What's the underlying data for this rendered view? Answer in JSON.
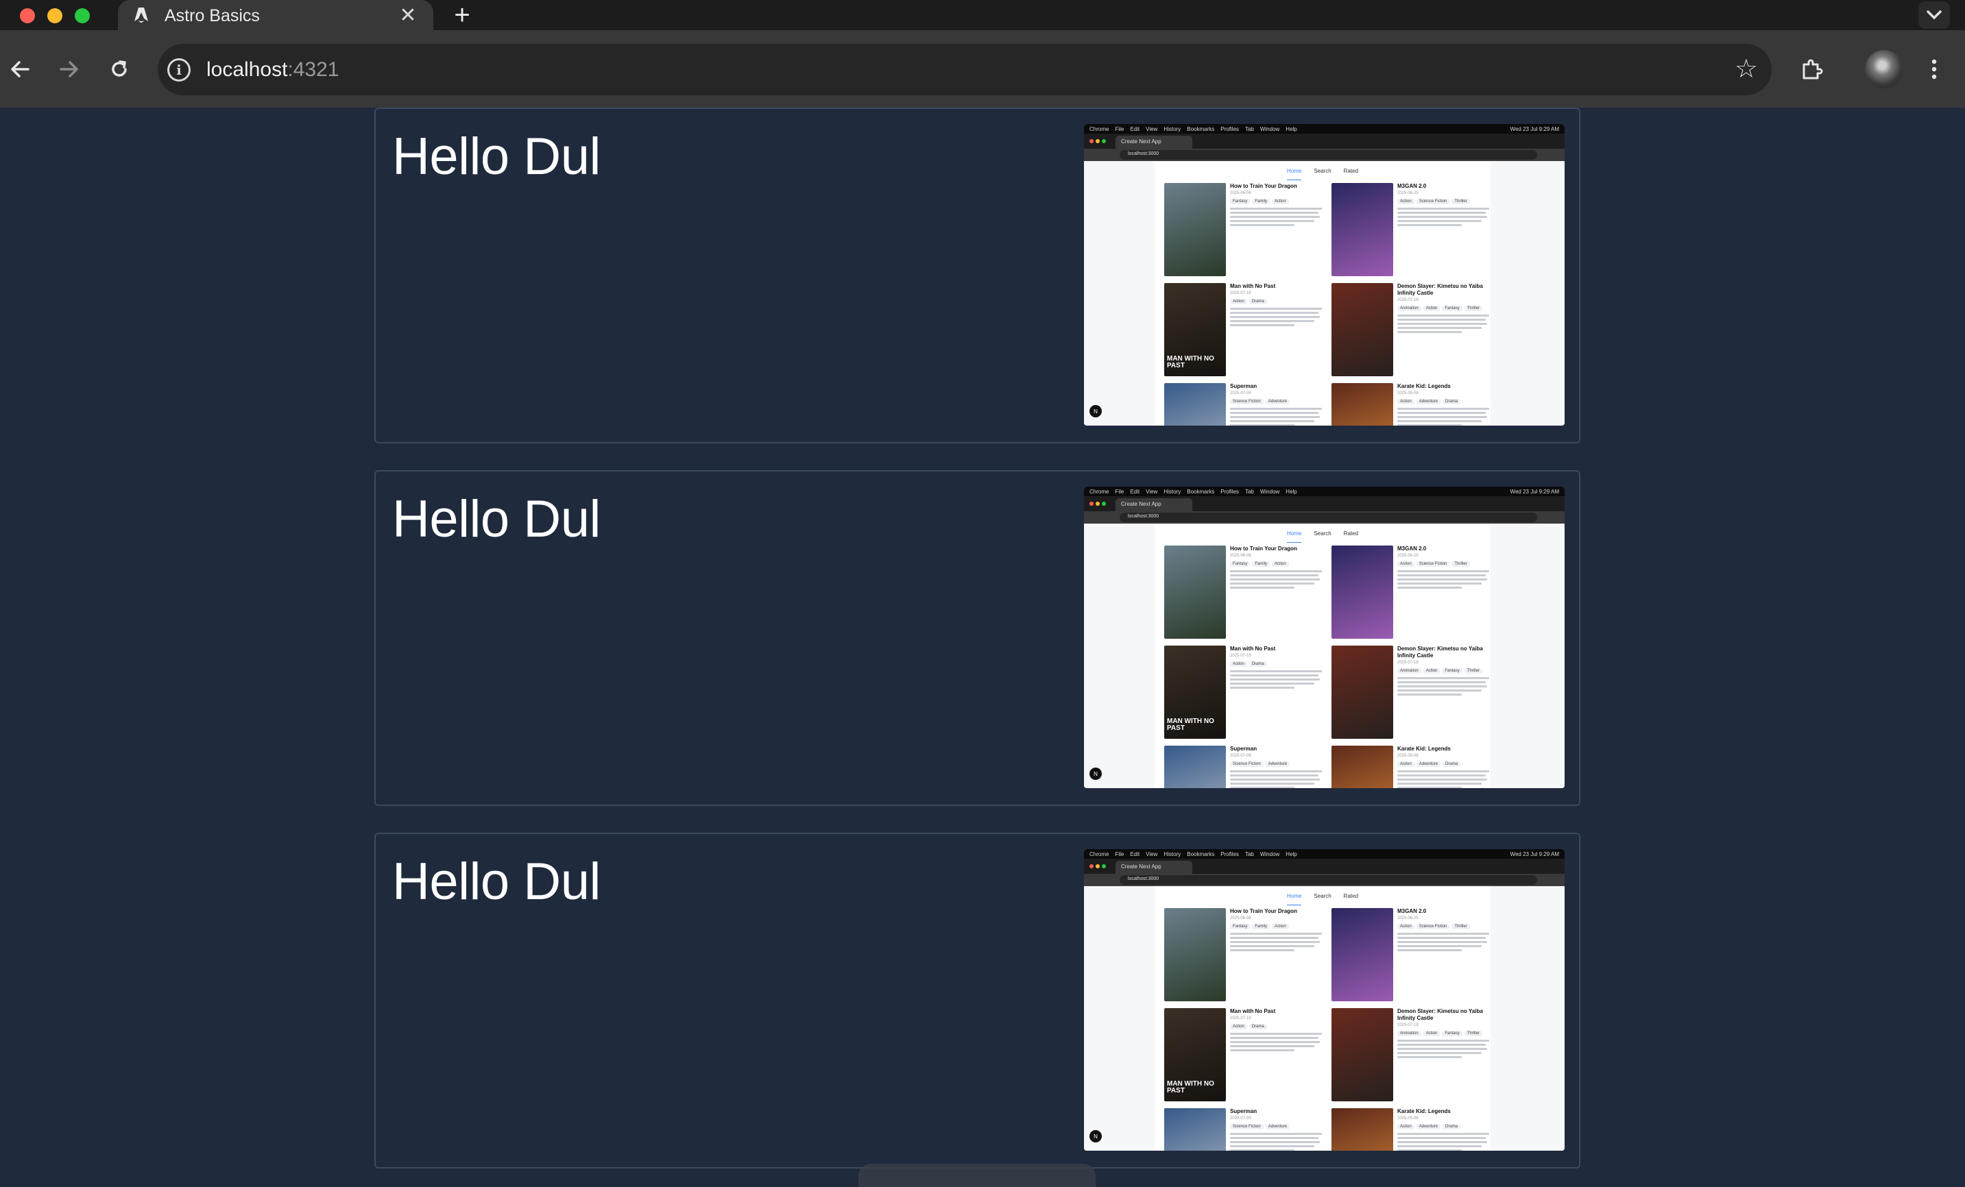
{
  "browser": {
    "tab_title": "Astro Basics",
    "tab_close": "✕",
    "new_tab": "+",
    "url_host": "localhost",
    "url_port": ":4321"
  },
  "cards": [
    {
      "title": "Hello Dul"
    },
    {
      "title": "Hello Dul"
    },
    {
      "title": "Hello Dul"
    }
  ],
  "screenshot": {
    "menubar": [
      "Chrome",
      "File",
      "Edit",
      "View",
      "History",
      "Bookmarks",
      "Profiles",
      "Tab",
      "Window",
      "Help"
    ],
    "clock": "Wed 23 Jul 9:29 AM",
    "tab_title": "Create Next App",
    "address": "localhost:3000",
    "nav": [
      "Home",
      "Search",
      "Rated"
    ],
    "badge": "N",
    "movies": [
      {
        "title": "How to Train Your Dragon",
        "date": "2025-06-06",
        "tags": [
          "Fantasy",
          "Family",
          "Action"
        ],
        "poster": [
          "#6b7f8c",
          "#2a3a28"
        ],
        "poster_text": ""
      },
      {
        "title": "M3GAN 2.0",
        "date": "2025-06-25",
        "tags": [
          "Action",
          "Science Fiction",
          "Thriller"
        ],
        "poster": [
          "#2a2760",
          "#9b5bb0"
        ],
        "poster_text": ""
      },
      {
        "title": "Man with No Past",
        "date": "2025-07-18",
        "tags": [
          "Action",
          "Drama"
        ],
        "poster": [
          "#3b3026",
          "#15120f"
        ],
        "poster_text": "MAN WITH NO PAST"
      },
      {
        "title": "Demon Slayer: Kimetsu no Yaiba Infinity Castle",
        "date": "2025-07-18",
        "tags": [
          "Animation",
          "Action",
          "Fantasy",
          "Thriller"
        ],
        "poster": [
          "#6a2a1e",
          "#27201e"
        ],
        "poster_text": ""
      },
      {
        "title": "Superman",
        "date": "2025-07-09",
        "tags": [
          "Science Fiction",
          "Adventure"
        ],
        "poster": [
          "#365a8a",
          "#b8bfc7"
        ],
        "poster_text": ""
      },
      {
        "title": "Karate Kid: Legends",
        "date": "2025-05-08",
        "tags": [
          "Action",
          "Adventure",
          "Drama"
        ],
        "poster": [
          "#5e2a1a",
          "#d8873a"
        ],
        "poster_text": ""
      }
    ]
  },
  "colors": {
    "page_bg": "#1f2a3c",
    "card_border": "#3c4a60",
    "toolbar": "#383838",
    "tabbar": "#1c1c1c",
    "accent": "#3b82f6"
  }
}
